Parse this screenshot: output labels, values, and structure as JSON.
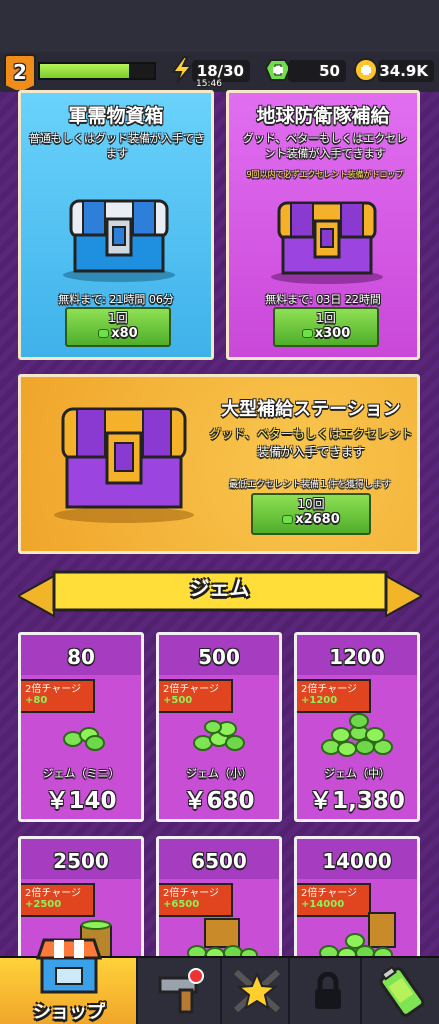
{
  "hud": {
    "level": "2",
    "xp_fraction": 0.78,
    "energy": "18/30",
    "energy_timer": "15:46",
    "gems": "50",
    "coins": "34.9K"
  },
  "supply_cards": [
    {
      "title": "軍需物資箱",
      "desc": "普通もしくはグッド装備が入手できます",
      "free_timer": "無料まで: 21時間 06分",
      "btn_top": "1回",
      "btn_cost": "x80"
    },
    {
      "title": "地球防衛隊補給",
      "desc": "グッド、ベターもしくはエクセレント装備が入手できます",
      "note": "9回以内で必ずエクセレント装備がドロップ",
      "free_timer": "無料まで: 03日 22時間",
      "btn_top": "1回",
      "btn_cost": "x300"
    }
  ],
  "big_station": {
    "title": "大型補給ステーション",
    "desc1": "グッド、ベターもしくはエクセレント",
    "desc2": "装備が入手できます",
    "note": "最低エクセレント装備１件を獲得します",
    "btn_top": "10回",
    "btn_cost": "x2680"
  },
  "gem_section_title": "ジェム",
  "gem_items": [
    {
      "amount": "80",
      "tag": "2倍チャージ",
      "bonus": "+80",
      "name": "ジェム（ミニ）",
      "price": "￥140"
    },
    {
      "amount": "500",
      "tag": "2倍チャージ",
      "bonus": "+500",
      "name": "ジェム（小）",
      "price": "￥680"
    },
    {
      "amount": "1200",
      "tag": "2倍チャージ",
      "bonus": "+1200",
      "name": "ジェム（中）",
      "price": "￥1,380"
    },
    {
      "amount": "2500",
      "tag": "2倍チャージ",
      "bonus": "+2500"
    },
    {
      "amount": "6500",
      "tag": "2倍チャージ",
      "bonus": "+6500"
    },
    {
      "amount": "14000",
      "tag": "2倍チャージ",
      "bonus": "+14000"
    }
  ],
  "nav": {
    "shop_label": "ショップ",
    "items": [
      "shop-icon",
      "weapon-icon",
      "star-swords-icon",
      "lock-icon",
      "battery-icon"
    ]
  },
  "colors": {
    "blue_card": "#4fc3f7",
    "purple_card": "#d35be3",
    "orange_card": "#f4b23a",
    "button_green": "#6fcb3b",
    "tag_red": "#e0451f"
  }
}
